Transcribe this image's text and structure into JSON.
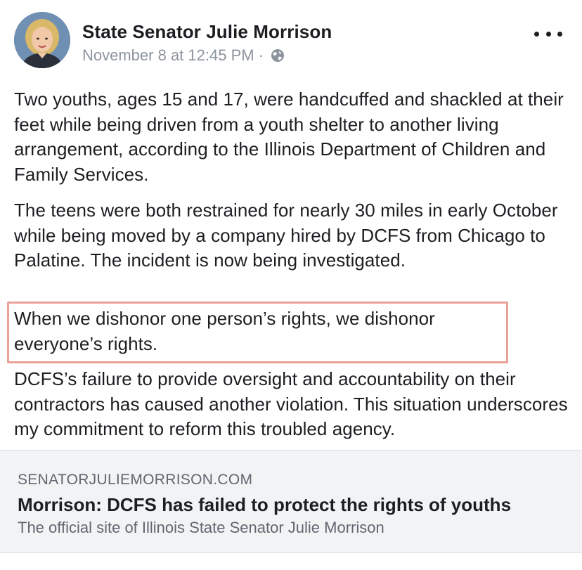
{
  "post": {
    "author": "State Senator Julie Morrison",
    "timestamp": "November 8 at 12:45 PM",
    "separator": "·",
    "privacy_icon": "globe-icon",
    "more_icon": "more-options-icon",
    "paragraphs": [
      "Two youths, ages 15 and 17, were handcuffed and shackled at their feet while being driven from a youth shelter to another living arrangement, according to the Illinois Department of Children and Family Services.",
      "The teens were both restrained for nearly 30 miles in early October while being moved by a company hired by DCFS from Chicago to Palatine. The incident is now being investigated.",
      "When we dishonor one person’s rights, we dishonor everyone’s rights.",
      "DCFS’s failure to provide oversight and accountability on their contractors has caused another violation. This situation underscores my commitment to reform this troubled agency."
    ],
    "highlight_color": "#e8a196"
  },
  "link_preview": {
    "domain": "SENATORJULIEMORRISON.COM",
    "title": "Morrison: DCFS has failed to protect the rights of youths",
    "description": "The official site of Illinois State Senator Julie Morrison"
  },
  "colors": {
    "text": "#1c1e21",
    "meta": "#8d949e",
    "preview_bg": "#f2f3f5"
  }
}
